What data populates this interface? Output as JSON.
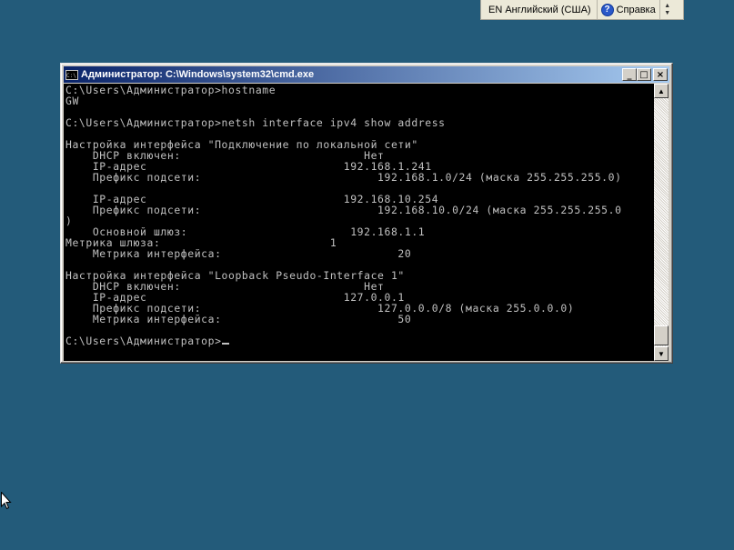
{
  "langbar": {
    "language": "EN Английский (США)",
    "help_label": "Справка",
    "options_glyph": "⌃⌄"
  },
  "window": {
    "title": "Администратор: C:\\Windows\\system32\\cmd.exe",
    "icon_text": "C:\\",
    "buttons": {
      "minimize": "_",
      "maximize": "□",
      "close": "×"
    }
  },
  "console": {
    "lines": [
      "C:\\Users\\Администратор>hostname",
      "GW",
      "",
      "C:\\Users\\Администратор>netsh interface ipv4 show address",
      "",
      "Настройка интерфейса \"Подключение по локальной сети\"",
      "    DHCP включен:                           Нет",
      "    IP-адрес                             192.168.1.241",
      "    Префикс подсети:                          192.168.1.0/24 (маска 255.255.255.0)",
      "",
      "    IP-адрес                             192.168.10.254",
      "    Префикс подсети:                          192.168.10.0/24 (маска 255.255.255.0",
      ")",
      "    Основной шлюз:                        192.168.1.1",
      "Метрика шлюза:                         1",
      "    Метрика интерфейса:                          20",
      "",
      "Настройка интерфейса \"Loopback Pseudo-Interface 1\"",
      "    DHCP включен:                           Нет",
      "    IP-адрес                             127.0.0.1",
      "    Префикс подсети:                          127.0.0.0/8 (маска 255.0.0.0)",
      "    Метрика интерфейса:                          50",
      "",
      "C:\\Users\\Администратор>"
    ]
  },
  "scrollbar": {
    "up_glyph": "▲",
    "down_glyph": "▼"
  }
}
